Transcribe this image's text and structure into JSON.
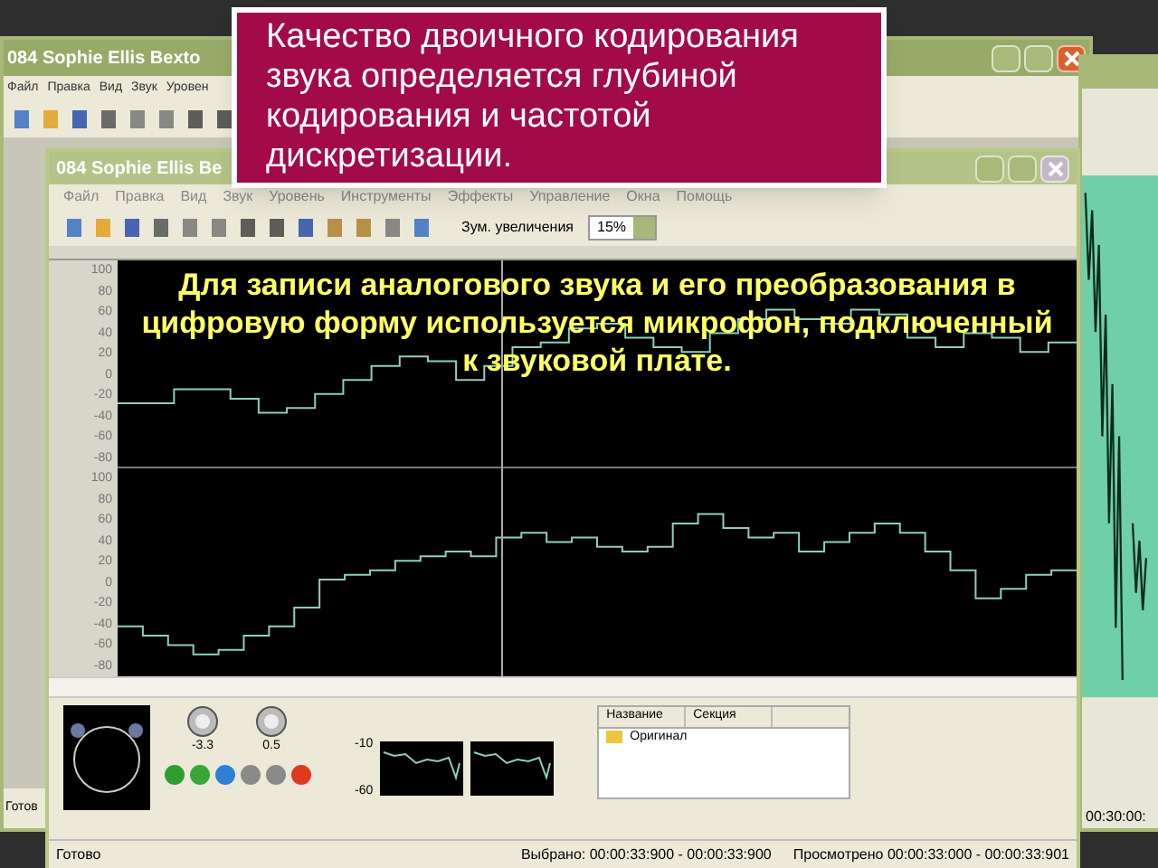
{
  "callout": "Качество двоичного кодирования звука определяется глубиной кодирования и частотой дискретизации.",
  "caption": "Для записи аналогового звука и его преобразования в цифровую форму используется микрофон, подключенный к звуковой плате.",
  "back_window": {
    "title": "084 Sophie Ellis Bexto",
    "menu": [
      "Файл",
      "Правка",
      "Вид",
      "Звук",
      "Уровен"
    ],
    "status": "Готов"
  },
  "right_window": {
    "status": "00:30:00:"
  },
  "front_window": {
    "title": "084 Sophie Ellis Be",
    "menu": [
      "Файл",
      "Правка",
      "Вид",
      "Звук",
      "Уровень",
      "Инструменты",
      "Эффекты",
      "Управление",
      "Окна",
      "Помощь"
    ],
    "zoom_label": "Зум. увеличения",
    "zoom_value": "15%",
    "channels": [
      {
        "axis_labels": [
          "100",
          "80",
          "60",
          "40",
          "20",
          "0",
          "-20",
          "-40",
          "-60",
          "-80"
        ]
      },
      {
        "axis_labels": [
          "100",
          "80",
          "60",
          "40",
          "20",
          "0",
          "-20",
          "-40",
          "-60",
          "-80"
        ]
      }
    ],
    "knobs": [
      "-3.3",
      "0.5"
    ],
    "transport": [
      {
        "color": "#2f9e2f"
      },
      {
        "color": "#3aa63a"
      },
      {
        "color": "#2f7fd6"
      },
      {
        "color": "#8a8a8a"
      },
      {
        "color": "#8a8a8a"
      },
      {
        "color": "#e03a1e"
      }
    ],
    "meter_ticks": [
      "-10",
      "-60"
    ],
    "list": {
      "columns": [
        "Название",
        "Секция"
      ],
      "items": [
        "Оригинал"
      ]
    },
    "status": [
      "Готово",
      "Выбрано: 00:00:33:900 - 00:00:33:900",
      "Просмотрено 00:00:33:000 - 00:00:33:901"
    ]
  }
}
